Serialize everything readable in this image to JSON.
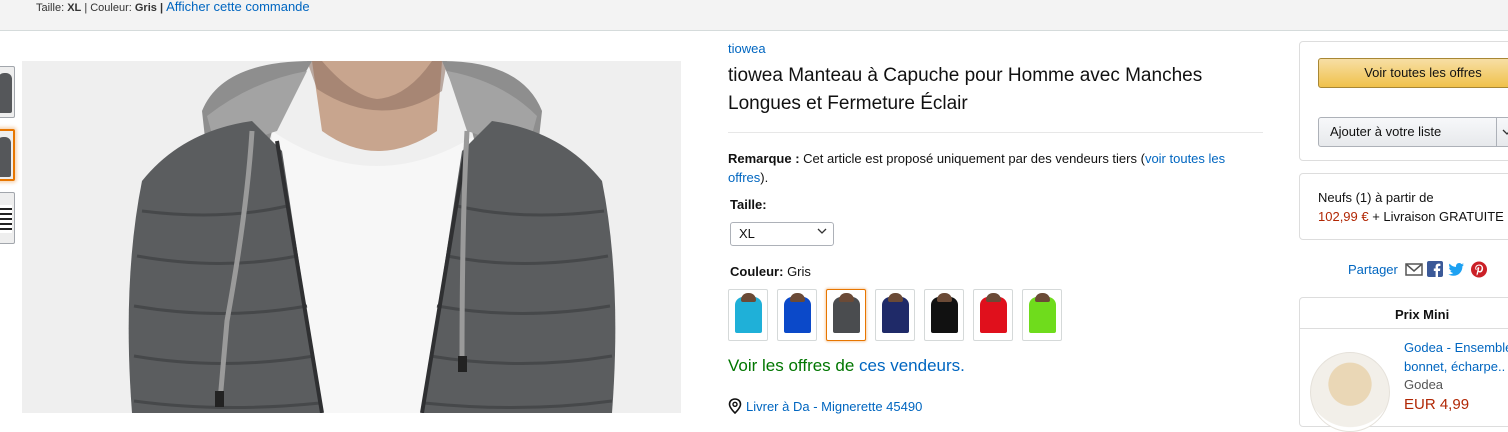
{
  "topbar": {
    "size_label": "Taille:",
    "size_value": "XL",
    "sep1": "|",
    "color_label": "Couleur:",
    "color_value": "Gris",
    "sep2": "|",
    "view_order_link": "Afficher cette commande"
  },
  "gallery": {
    "thumb_count": 3,
    "selected_thumb": 2
  },
  "product": {
    "brand": "tiowea",
    "title": "tiowea Manteau à Capuche pour Homme avec Manches Longues et Fermeture Éclair",
    "note_label": "Remarque :",
    "note_text": " Cet article est proposé uniquement par des vendeurs tiers (",
    "note_link": "voir toutes les offres",
    "note_end": ").",
    "size_label": "Taille:",
    "size_selected": "XL",
    "color_label": "Couleur:",
    "color_value": " Gris",
    "swatches": [
      {
        "name": "Bleu ciel",
        "color": "#1fb0d8"
      },
      {
        "name": "Bleu",
        "color": "#0b49c9"
      },
      {
        "name": "Gris",
        "color": "#4a4c4f",
        "selected": true
      },
      {
        "name": "Marine",
        "color": "#1f2a68"
      },
      {
        "name": "Noir",
        "color": "#111111"
      },
      {
        "name": "Rouge",
        "color": "#e0101c"
      },
      {
        "name": "Vert",
        "color": "#6fdc1c"
      }
    ],
    "offers_prefix": "Voir les offres de ",
    "offers_link": "ces vendeurs.",
    "deliver_text": "Livrer à Da - Mignerette 45490"
  },
  "buybox": {
    "see_offers": "Voir toutes les offres",
    "add_to_list": "Ajouter à votre liste",
    "new_label": "Neufs (1) à partir de",
    "new_price": "102,99 €",
    "shipping": " + Livraison GRATUITE"
  },
  "share": {
    "label": "Partager",
    "icons": [
      "email-icon",
      "facebook-icon",
      "twitter-icon",
      "pinterest-icon"
    ],
    "colors": {
      "facebook": "#3b5998",
      "twitter": "#1da1f2",
      "pinterest": "#cb2027"
    }
  },
  "prix_mini": {
    "header": "Prix Mini",
    "item_title_line1": "Godea - Ensemble",
    "item_title_line2": "bonnet, écharpe..",
    "item_brand": "Godea",
    "item_price": "EUR 4,99"
  },
  "colors": {
    "link": "#0066c0",
    "price": "#b12704",
    "green": "#007600",
    "selected_border": "#e77600"
  }
}
